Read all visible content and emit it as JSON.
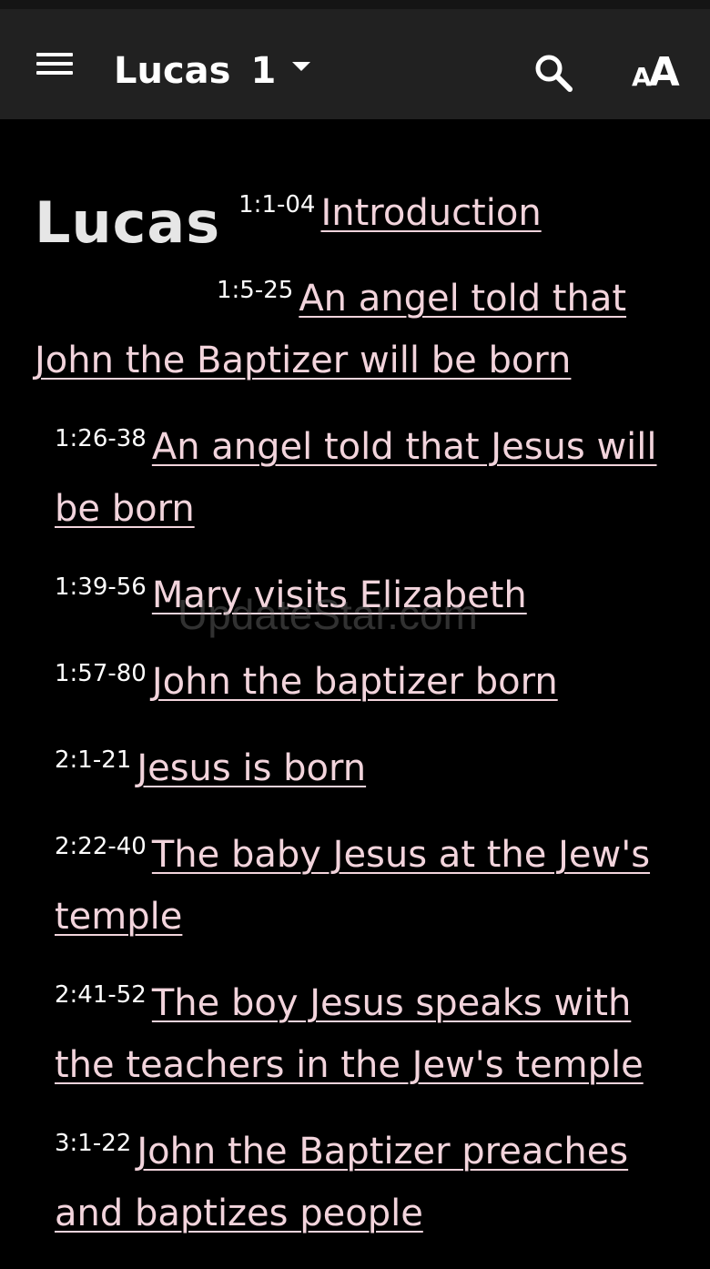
{
  "header": {
    "book": "Lucas",
    "chapter": "1"
  },
  "content": {
    "book_heading": "Lucas",
    "sections": [
      {
        "ref": "1:1-04",
        "title": "Introduction"
      },
      {
        "ref": "1:5-25",
        "title": "An angel told that John the Baptizer will be born"
      },
      {
        "ref": "1:26-38",
        "title": "An angel told that Jesus will be born"
      },
      {
        "ref": "1:39-56",
        "title": "Mary visits Elizabeth"
      },
      {
        "ref": "1:57-80",
        "title": "John the baptizer born"
      },
      {
        "ref": "2:1-21",
        "title": "Jesus is born"
      },
      {
        "ref": "2:22-40",
        "title": "The baby Jesus at the Jew's temple"
      },
      {
        "ref": "2:41-52",
        "title": "The boy Jesus speaks with the teachers in the Jew's temple"
      },
      {
        "ref": "3:1-22",
        "title": "John the Baptizer preaches and baptizes people"
      }
    ]
  },
  "watermark": "UpdateStar.com",
  "colors": {
    "background": "#000000",
    "appbar": "#212121",
    "link": "#f2d4dc"
  },
  "icons": [
    "menu-icon",
    "dropdown-caret-icon",
    "search-icon",
    "font-size-icon"
  ]
}
